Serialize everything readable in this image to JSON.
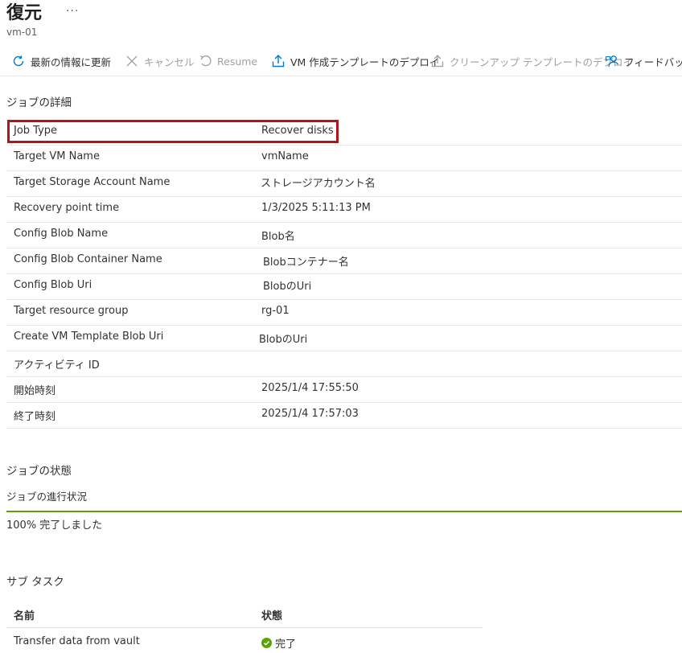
{
  "header": {
    "title": "復元",
    "subtitle": "vm-01",
    "more": "···"
  },
  "toolbar": {
    "refresh": "最新の情報に更新",
    "cancel": "キャンセル",
    "resume": "Resume",
    "deploy_template": "VM 作成テンプレートのデプロイ",
    "cleanup_template": "クリーンアップ テンプレートのデプロイ",
    "feedback": "フィードバック"
  },
  "job_details": {
    "heading": "ジョブの詳細",
    "rows": [
      {
        "key": "Job Type",
        "value": "Recover disks"
      },
      {
        "key": "Target VM Name",
        "value": "vmName"
      },
      {
        "key": "Target Storage Account Name",
        "value": "ストレージアカウント名"
      },
      {
        "key": "Recovery point time",
        "value": "1/3/2025 5:11:13 PM"
      },
      {
        "key": "Config Blob Name",
        "value": "Blob名"
      },
      {
        "key": "Config Blob Container Name",
        "value": "Blobコンテナー名"
      },
      {
        "key": "Config Blob Uri",
        "value": "BlobのUri"
      },
      {
        "key": "Target resource group",
        "value": "rg-01"
      },
      {
        "key": "Create VM Template Blob Uri",
        "value": "BlobのUri"
      },
      {
        "key": "アクティビティ ID",
        "value": ""
      },
      {
        "key": "開始時刻",
        "value": "2025/1/4 17:55:50"
      },
      {
        "key": "終了時刻",
        "value": "2025/1/4 17:57:03"
      }
    ]
  },
  "job_status": {
    "heading": "ジョブの状態",
    "progress_label": "ジョブの進行状況",
    "progress_percent": 100,
    "progress_text": "100% 完了しました"
  },
  "subtasks": {
    "heading": "サブ タスク",
    "columns": [
      "名前",
      "状態"
    ],
    "rows": [
      {
        "name": "Transfer data from vault",
        "status": "完了"
      }
    ]
  },
  "colors": {
    "accent": "#0078d4",
    "highlight": "#b3141c",
    "success": "#57a300"
  }
}
